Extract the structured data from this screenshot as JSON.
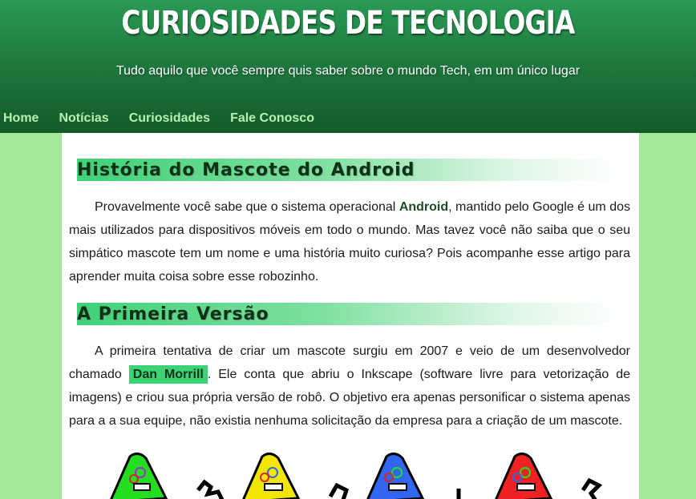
{
  "header": {
    "title": "CURIOSIDADES DE TECNOLOGIA",
    "subtitle": "Tudo aquilo que você sempre quis saber sobre o mundo Tech, em um único lugar"
  },
  "nav": {
    "items": [
      {
        "label": "Home"
      },
      {
        "label": "Notícias"
      },
      {
        "label": "Curiosidades"
      },
      {
        "label": "Fale Conosco"
      }
    ]
  },
  "article": {
    "heading1": "História do Mascote do Android",
    "p1_before": "Provavelmente você sabe que o sistema operacional ",
    "p1_bold": "Android",
    "p1_after": ", mantido pelo Google é um dos mais utilizados para dispositivos móveis em todo o mundo. Mas tavez você não saiba que o seu simpático mascote tem um nome e uma história muito curiosa? Pois acompanhe esse artigo para aprender muita coisa sobre esse robozinho.",
    "heading2": "A Primeira Versão",
    "p2_before": "A primeira tentativa de criar um mascote surgiu em 2007 e veio de um desenvolvedor chamado ",
    "p2_highlight": "Dan Morrill",
    "p2_after": ". Ele conta que abriu o Inkscape (software livre para vetorização de imagens) e criou sua própria versão de robô. O objetivo era apenas personificar o sistema apenas para a a sua equipe, não existia nenhuma solicitação da empresa para a criação de um mascote."
  },
  "colors": {
    "header_green": "#1f7a3f",
    "page_background": "#a4e89a",
    "accent_green": "#3ed277",
    "mascots": [
      "#22dd22",
      "#f2e600",
      "#3366ee",
      "#ee2222"
    ]
  }
}
